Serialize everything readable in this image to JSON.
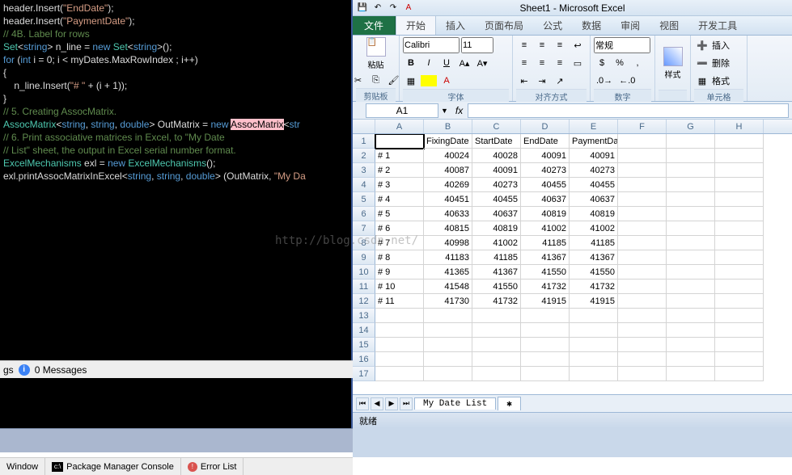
{
  "vs": {
    "lines": [
      {
        "t": "code",
        "tokens": [
          {
            "c": "id",
            "v": "header.Insert("
          },
          {
            "c": "str",
            "v": "\"EndDate\""
          },
          {
            "c": "id",
            "v": ");"
          }
        ]
      },
      {
        "t": "code",
        "tokens": [
          {
            "c": "id",
            "v": "header.Insert("
          },
          {
            "c": "str",
            "v": "\"PaymentDate\""
          },
          {
            "c": "id",
            "v": ");"
          }
        ]
      },
      {
        "t": "comm",
        "v": "// 4B. Label for rows"
      },
      {
        "t": "code",
        "tokens": [
          {
            "c": "type",
            "v": "Set"
          },
          {
            "c": "id",
            "v": "<"
          },
          {
            "c": "kw",
            "v": "string"
          },
          {
            "c": "id",
            "v": "> n_line = "
          },
          {
            "c": "kw",
            "v": "new "
          },
          {
            "c": "type",
            "v": "Set"
          },
          {
            "c": "id",
            "v": "<"
          },
          {
            "c": "kw",
            "v": "string"
          },
          {
            "c": "id",
            "v": ">();"
          }
        ]
      },
      {
        "t": "code",
        "tokens": [
          {
            "c": "kw",
            "v": "for "
          },
          {
            "c": "id",
            "v": "("
          },
          {
            "c": "kw",
            "v": "int"
          },
          {
            "c": "id",
            "v": " i = 0; i < myDates.MaxRowIndex ; i++)"
          }
        ]
      },
      {
        "t": "code",
        "tokens": [
          {
            "c": "id",
            "v": "{"
          }
        ]
      },
      {
        "t": "code",
        "tokens": [
          {
            "c": "id",
            "v": "    n_line.Insert("
          },
          {
            "c": "str",
            "v": "\"# \""
          },
          {
            "c": "id",
            "v": " + (i + 1));"
          }
        ]
      },
      {
        "t": "code",
        "tokens": [
          {
            "c": "id",
            "v": "}"
          }
        ]
      },
      {
        "t": "comm",
        "v": "// 5. Creating AssocMatrix."
      },
      {
        "t": "code",
        "tokens": [
          {
            "c": "type",
            "v": "AssocMatrix"
          },
          {
            "c": "id",
            "v": "<"
          },
          {
            "c": "kw",
            "v": "string"
          },
          {
            "c": "id",
            "v": ", "
          },
          {
            "c": "kw",
            "v": "string"
          },
          {
            "c": "id",
            "v": ", "
          },
          {
            "c": "kw",
            "v": "double"
          },
          {
            "c": "id",
            "v": "> OutMatrix = "
          },
          {
            "c": "kw",
            "v": "new "
          },
          {
            "c": "hl",
            "v": "AssocMatrix"
          },
          {
            "c": "id",
            "v": "<"
          },
          {
            "c": "kw",
            "v": "str"
          }
        ]
      },
      {
        "t": "comm",
        "v": "// 6. Print associative matrices in Excel, to \"My Date"
      },
      {
        "t": "comm",
        "v": "// List\" sheet, the output in Excel serial number format."
      },
      {
        "t": "code",
        "tokens": [
          {
            "c": "type",
            "v": "ExcelMechanisms"
          },
          {
            "c": "id",
            "v": " exl = "
          },
          {
            "c": "kw",
            "v": "new "
          },
          {
            "c": "type",
            "v": "ExcelMechanisms"
          },
          {
            "c": "id",
            "v": "();"
          }
        ]
      },
      {
        "t": "code",
        "tokens": [
          {
            "c": "id",
            "v": "exl.printAssocMatrixInExcel<"
          },
          {
            "c": "kw",
            "v": "string"
          },
          {
            "c": "id",
            "v": ", "
          },
          {
            "c": "kw",
            "v": "string"
          },
          {
            "c": "id",
            "v": ", "
          },
          {
            "c": "kw",
            "v": "double"
          },
          {
            "c": "id",
            "v": "> (OutMatrix, "
          },
          {
            "c": "str",
            "v": "\"My Da"
          }
        ]
      }
    ],
    "msg_gs": "gs",
    "msg_count": "0 Messages"
  },
  "excel": {
    "title": "Sheet1 - Microsoft Excel",
    "tabs": {
      "file": "文件",
      "start": "开始",
      "insert": "插入",
      "layout": "页面布局",
      "formula": "公式",
      "data": "数据",
      "review": "审阅",
      "view": "视图",
      "dev": "开发工具"
    },
    "ribbon": {
      "clipboard": {
        "paste": "粘贴",
        "label": "剪贴板"
      },
      "font": {
        "name": "Calibri",
        "size": "11",
        "bold": "B",
        "italic": "I",
        "underline": "U",
        "label": "字体"
      },
      "align": {
        "label": "对齐方式"
      },
      "number": {
        "general": "常规",
        "label": "数字"
      },
      "styles": {
        "btn": "样式",
        "label": ""
      },
      "cells": {
        "insert": "插入",
        "delete": "删除",
        "format": "格式",
        "label": "单元格"
      }
    },
    "namebox": "A1",
    "fx": "fx",
    "columns": [
      "A",
      "B",
      "C",
      "D",
      "E",
      "F",
      "G",
      "H"
    ],
    "header_row": [
      "",
      "FixingDate",
      "StartDate",
      "EndDate",
      "PaymentDate",
      "",
      "",
      ""
    ],
    "rows": [
      {
        "n": 2,
        "cells": [
          "# 1",
          "40024",
          "40028",
          "40091",
          "40091",
          "",
          "",
          ""
        ]
      },
      {
        "n": 3,
        "cells": [
          "# 2",
          "40087",
          "40091",
          "40273",
          "40273",
          "",
          "",
          ""
        ]
      },
      {
        "n": 4,
        "cells": [
          "# 3",
          "40269",
          "40273",
          "40455",
          "40455",
          "",
          "",
          ""
        ]
      },
      {
        "n": 5,
        "cells": [
          "# 4",
          "40451",
          "40455",
          "40637",
          "40637",
          "",
          "",
          ""
        ]
      },
      {
        "n": 6,
        "cells": [
          "# 5",
          "40633",
          "40637",
          "40819",
          "40819",
          "",
          "",
          ""
        ]
      },
      {
        "n": 7,
        "cells": [
          "# 6",
          "40815",
          "40819",
          "41002",
          "41002",
          "",
          "",
          ""
        ]
      },
      {
        "n": 8,
        "cells": [
          "# 7",
          "40998",
          "41002",
          "41185",
          "41185",
          "",
          "",
          ""
        ]
      },
      {
        "n": 9,
        "cells": [
          "# 8",
          "41183",
          "41185",
          "41367",
          "41367",
          "",
          "",
          ""
        ]
      },
      {
        "n": 10,
        "cells": [
          "# 9",
          "41365",
          "41367",
          "41550",
          "41550",
          "",
          "",
          ""
        ]
      },
      {
        "n": 11,
        "cells": [
          "# 10",
          "41548",
          "41550",
          "41732",
          "41732",
          "",
          "",
          ""
        ]
      },
      {
        "n": 12,
        "cells": [
          "# 11",
          "41730",
          "41732",
          "41915",
          "41915",
          "",
          "",
          ""
        ]
      },
      {
        "n": 13,
        "cells": [
          "",
          "",
          "",
          "",
          "",
          "",
          "",
          ""
        ]
      },
      {
        "n": 14,
        "cells": [
          "",
          "",
          "",
          "",
          "",
          "",
          "",
          ""
        ]
      },
      {
        "n": 15,
        "cells": [
          "",
          "",
          "",
          "",
          "",
          "",
          "",
          ""
        ]
      },
      {
        "n": 16,
        "cells": [
          "",
          "",
          "",
          "",
          "",
          "",
          "",
          ""
        ]
      },
      {
        "n": 17,
        "cells": [
          "",
          "",
          "",
          "",
          "",
          "",
          "",
          ""
        ]
      }
    ],
    "sheet_tab": "My Date List",
    "status": "就绪"
  },
  "bottom": {
    "window": "Window",
    "pkg": "Package Manager Console",
    "err": "Error List"
  },
  "watermark": "http://blog.csdn.net/"
}
